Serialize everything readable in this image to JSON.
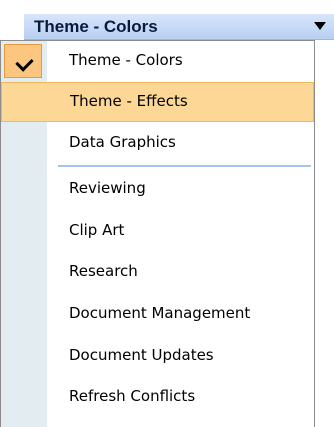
{
  "header": {
    "title": "Theme - Colors"
  },
  "menu": {
    "items": [
      {
        "label": "Theme - Colors",
        "checked": true
      },
      {
        "label": "Theme - Effects",
        "highlighted": true
      },
      {
        "label": "Data Graphics"
      },
      {
        "label": "Reviewing"
      },
      {
        "label": "Clip Art"
      },
      {
        "label": "Research"
      },
      {
        "label": "Document Management"
      },
      {
        "label": "Document Updates"
      },
      {
        "label": "Refresh Conflicts"
      }
    ]
  },
  "colors": {
    "header_bg": "#c7daf7",
    "gutter_bg": "#e2ecf1",
    "highlight_bg": "#fcd795",
    "check_bg": "#fcc580",
    "separator": "#a6c2ef"
  }
}
